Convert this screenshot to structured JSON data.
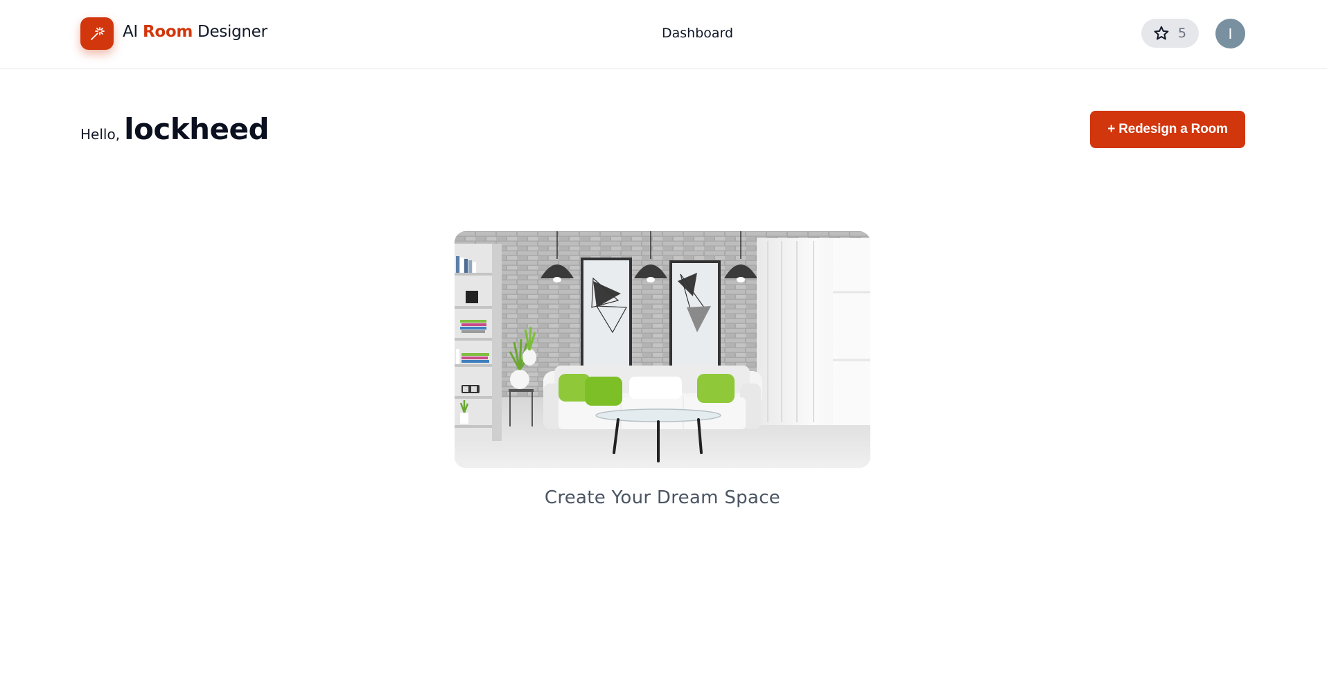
{
  "header": {
    "brand": {
      "prefix": "AI",
      "accent": "Room",
      "suffix": "Designer"
    },
    "nav": {
      "dashboard_label": "Dashboard"
    },
    "credits": {
      "count": "5",
      "icon": "star-icon"
    },
    "avatar": {
      "initial": "I"
    },
    "logo_icon": "magic-wand-icon"
  },
  "greeting": {
    "hello_label": "Hello,",
    "username": "lockheed"
  },
  "actions": {
    "redesign_label": "+ Redesign a Room"
  },
  "hero": {
    "caption": "Create Your Dream Space"
  },
  "colors": {
    "brand_accent": "#d2360d",
    "avatar_bg": "#7890a0",
    "pill_bg": "#e5e7eb"
  }
}
